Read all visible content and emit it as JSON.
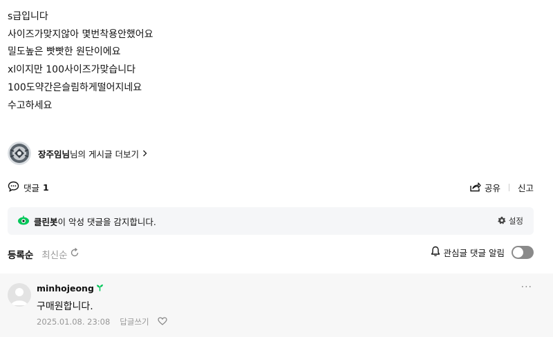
{
  "post": {
    "lines": [
      "s급입니다",
      "사이즈가맞지않아 몇번착용안했어요",
      "밀도높은 빳빳한 원단이에요",
      "xl이지만 100사이즈가맞습니다",
      "100도약간은슬림하게떨어지네요",
      "수고하세요"
    ]
  },
  "author": {
    "name": "장주임님",
    "suffix": "님의 게시글 더보기"
  },
  "comments_header": {
    "label": "댓글",
    "count": "1"
  },
  "actions": {
    "share": "공유",
    "report": "신고"
  },
  "cleanbot": {
    "name": "클린봇",
    "message": "이 악성 댓글을 감지합니다.",
    "settings": "설정"
  },
  "sort": {
    "registered": "등록순",
    "latest": "최신순"
  },
  "notify": {
    "label": "관심글 댓글 알림",
    "enabled": false
  },
  "comment": {
    "author": "minhojeong",
    "text": "구매원합니다.",
    "date": "2025.01.08. 23:08",
    "reply": "답글쓰기"
  },
  "colors": {
    "accent_green": "#03c75a",
    "toggle_off": "#8a8a8a"
  }
}
